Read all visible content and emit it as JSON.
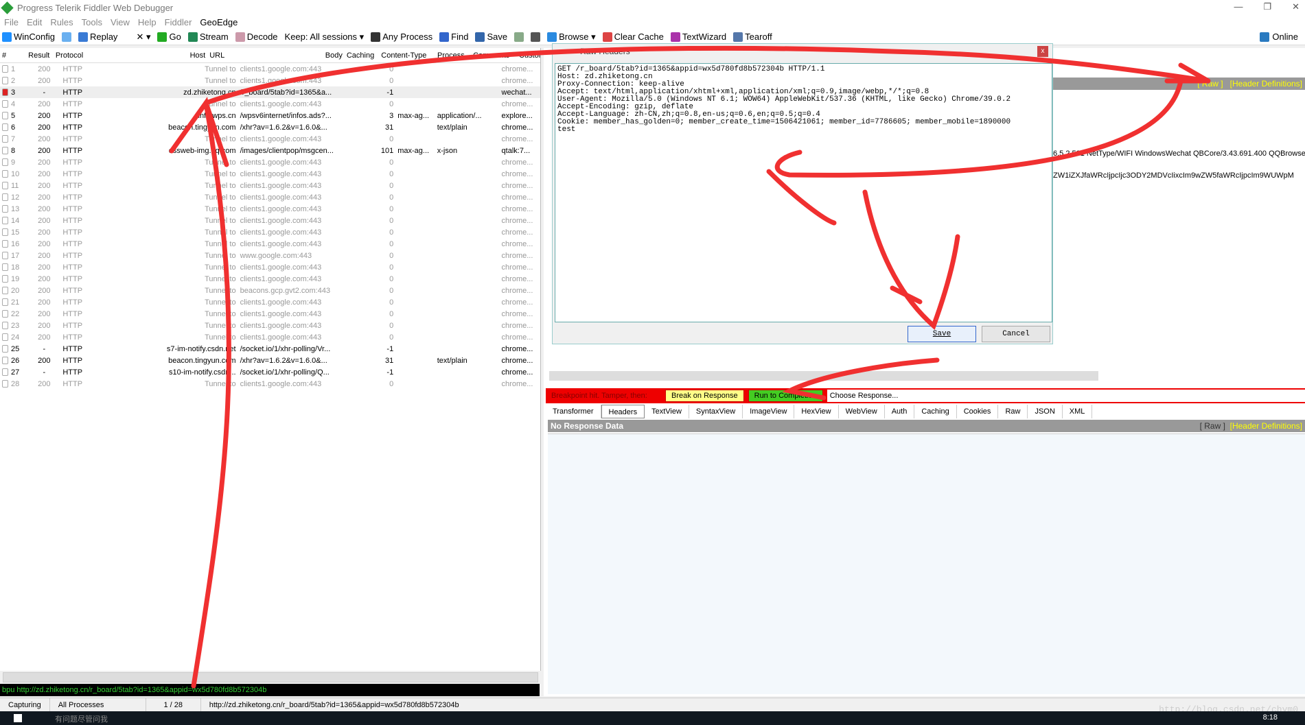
{
  "window": {
    "title": "Progress Telerik Fiddler Web Debugger",
    "controls": [
      "—",
      "❐",
      "✕"
    ]
  },
  "menu": [
    "File",
    "Edit",
    "Rules",
    "Tools",
    "View",
    "Help",
    "Fiddler",
    "GeoEdge"
  ],
  "toolbar": [
    {
      "label": "WinConfig",
      "icon": "windows-icon",
      "color": "#1e90ff"
    },
    {
      "label": "",
      "icon": "comment-icon",
      "color": "#6ab0f0"
    },
    {
      "label": "Replay",
      "icon": "replay-icon",
      "color": "#3a7bd5"
    },
    {
      "label": "✕ ▾",
      "icon": "remove-icon",
      "color": "#fff"
    },
    {
      "label": "Go",
      "icon": "play-icon",
      "color": "#2a2"
    },
    {
      "label": "Stream",
      "icon": "stream-icon",
      "color": "#285"
    },
    {
      "label": "Decode",
      "icon": "decode-icon",
      "color": "#c9a"
    },
    {
      "label": "Keep: All sessions ▾",
      "icon": "",
      "color": ""
    },
    {
      "label": "Any Process",
      "icon": "crosshair-icon",
      "color": "#333"
    },
    {
      "label": "Find",
      "icon": "binoculars-icon",
      "color": "#36c"
    },
    {
      "label": "Save",
      "icon": "save-icon",
      "color": "#36a"
    },
    {
      "label": "",
      "icon": "screenshot-icon",
      "color": "#8a8"
    },
    {
      "label": "",
      "icon": "timer-icon",
      "color": "#555"
    },
    {
      "label": "Browse ▾",
      "icon": "ie-icon",
      "color": "#2a8ae0"
    },
    {
      "label": "Clear Cache",
      "icon": "clear-cache-icon",
      "color": "#d44"
    },
    {
      "label": "TextWizard",
      "icon": "textwizard-icon",
      "color": "#a3a"
    },
    {
      "label": "Tearoff",
      "icon": "tearoff-icon",
      "color": "#57a"
    }
  ],
  "online": "Online",
  "sessions": {
    "columns": [
      "#",
      "Result",
      "Protocol",
      "Host",
      "URL",
      "Body",
      "Caching",
      "Content-Type",
      "Process",
      "Comments",
      "Custom"
    ],
    "rows": [
      [
        "1",
        "200",
        "HTTP",
        "Tunnel to",
        "clients1.google.com:443",
        "0",
        "",
        "",
        "chrome..."
      ],
      [
        "2",
        "200",
        "HTTP",
        "Tunnel to",
        "clients1.google.com:443",
        "0",
        "",
        "",
        "chrome..."
      ],
      [
        "3",
        "-",
        "HTTP",
        "zd.zhiketong.cn",
        "/r_board/5tab?id=1365&a...",
        "-1",
        "",
        "",
        "wechat..."
      ],
      [
        "4",
        "200",
        "HTTP",
        "Tunnel to",
        "clients1.google.com:443",
        "0",
        "",
        "",
        "chrome..."
      ],
      [
        "5",
        "200",
        "HTTP",
        "info.wps.cn",
        "/wpsv6internet/infos.ads?...",
        "3",
        "max-ag...",
        "application/...",
        "explore..."
      ],
      [
        "6",
        "200",
        "HTTP",
        "beacon.tingyun.com",
        "/xhr?av=1.6.2&v=1.6.0&...",
        "31",
        "",
        "text/plain",
        "chrome..."
      ],
      [
        "7",
        "200",
        "HTTP",
        "Tunnel to",
        "clients1.google.com:443",
        "0",
        "",
        "",
        "chrome..."
      ],
      [
        "8",
        "200",
        "HTTP",
        "ossweb-img.qq.com",
        "/images/clientpop/msgcen...",
        "101",
        "max-ag...",
        "x-json",
        "qtalk:7..."
      ],
      [
        "9",
        "200",
        "HTTP",
        "Tunnel to",
        "clients1.google.com:443",
        "0",
        "",
        "",
        "chrome..."
      ],
      [
        "10",
        "200",
        "HTTP",
        "Tunnel to",
        "clients1.google.com:443",
        "0",
        "",
        "",
        "chrome..."
      ],
      [
        "11",
        "200",
        "HTTP",
        "Tunnel to",
        "clients1.google.com:443",
        "0",
        "",
        "",
        "chrome..."
      ],
      [
        "12",
        "200",
        "HTTP",
        "Tunnel to",
        "clients1.google.com:443",
        "0",
        "",
        "",
        "chrome..."
      ],
      [
        "13",
        "200",
        "HTTP",
        "Tunnel to",
        "clients1.google.com:443",
        "0",
        "",
        "",
        "chrome..."
      ],
      [
        "14",
        "200",
        "HTTP",
        "Tunnel to",
        "clients1.google.com:443",
        "0",
        "",
        "",
        "chrome..."
      ],
      [
        "15",
        "200",
        "HTTP",
        "Tunnel to",
        "clients1.google.com:443",
        "0",
        "",
        "",
        "chrome..."
      ],
      [
        "16",
        "200",
        "HTTP",
        "Tunnel to",
        "clients1.google.com:443",
        "0",
        "",
        "",
        "chrome..."
      ],
      [
        "17",
        "200",
        "HTTP",
        "Tunnel to",
        "www.google.com:443",
        "0",
        "",
        "",
        "chrome..."
      ],
      [
        "18",
        "200",
        "HTTP",
        "Tunnel to",
        "clients1.google.com:443",
        "0",
        "",
        "",
        "chrome..."
      ],
      [
        "19",
        "200",
        "HTTP",
        "Tunnel to",
        "clients1.google.com:443",
        "0",
        "",
        "",
        "chrome..."
      ],
      [
        "20",
        "200",
        "HTTP",
        "Tunnel to",
        "beacons.gcp.gvt2.com:443",
        "0",
        "",
        "",
        "chrome..."
      ],
      [
        "21",
        "200",
        "HTTP",
        "Tunnel to",
        "clients1.google.com:443",
        "0",
        "",
        "",
        "chrome..."
      ],
      [
        "22",
        "200",
        "HTTP",
        "Tunnel to",
        "clients1.google.com:443",
        "0",
        "",
        "",
        "chrome..."
      ],
      [
        "23",
        "200",
        "HTTP",
        "Tunnel to",
        "clients1.google.com:443",
        "0",
        "",
        "",
        "chrome..."
      ],
      [
        "24",
        "200",
        "HTTP",
        "Tunnel to",
        "clients1.google.com:443",
        "0",
        "",
        "",
        "chrome..."
      ],
      [
        "25",
        "-",
        "HTTP",
        "s7-im-notify.csdn.net",
        "/socket.io/1/xhr-polling/Vr...",
        "-1",
        "",
        "",
        "chrome..."
      ],
      [
        "26",
        "200",
        "HTTP",
        "beacon.tingyun.com",
        "/xhr?av=1.6.2&v=1.6.0&...",
        "31",
        "",
        "text/plain",
        "chrome..."
      ],
      [
        "27",
        "-",
        "HTTP",
        "s10-im-notify.csdn...",
        "/socket.io/1/xhr-polling/Q...",
        "-1",
        "",
        "",
        "chrome..."
      ],
      [
        "28",
        "200",
        "HTTP",
        "Tunnel to",
        "clients1.google.com:443",
        "0",
        "",
        "",
        "chrome..."
      ]
    ]
  },
  "quickexec": "bpu http://zd.zhiketong.cn/r_board/5tab?id=1365&appid=wx5d780fd8b572304b",
  "status": {
    "capture": "Capturing",
    "filter": "All Processes",
    "count": "1 / 28",
    "url": "http://zd.zhiketong.cn/r_board/5tab?id=1365&appid=wx5d780fd8b572304b"
  },
  "taskbar": {
    "search": "有问题尽管问我",
    "time": "8:18"
  },
  "request_pane": {
    "raw": "[ Raw ]",
    "header_defs": "[Header Definitions]",
    "ua_fragment": "6.5.2.501 NetType/WIFI WindowsWechat QBCore/3.43.691.400 QQBrowser",
    "cookie_fragment": "ZW1iZXJfaWRcIjpcIjc3ODY2MDVcIixcIm9wZW5faWRcIjpcIm9WUWpM"
  },
  "dialog": {
    "title": "Raw Headers",
    "close": "x",
    "text": "GET /r_board/5tab?id=1365&appid=wx5d780fd8b572304b HTTP/1.1\nHost: zd.zhiketong.cn\nProxy-Connection: keep-alive\nAccept: text/html,application/xhtml+xml,application/xml;q=0.9,image/webp,*/*;q=0.8\nUser-Agent: Mozilla/5.0 (Windows NT 6.1; WOW64) AppleWebKit/537.36 (KHTML, like Gecko) Chrome/39.0.2\nAccept-Encoding: gzip, deflate\nAccept-Language: zh-CN,zh;q=0.8,en-us;q=0.6,en;q=0.5;q=0.4\nCookie: member_has_golden=0; member_create_time=1506421061; member_id=7786605; member_mobile=1890000\ntest",
    "save": "Save",
    "cancel": "Cancel"
  },
  "breakpoint": {
    "label": "Breakpoint hit. Tamper, then:",
    "break_on_response": "Break on Response",
    "run_to_completion": "Run to Completion",
    "choose_response": "Choose Response..."
  },
  "response_tabs": [
    "Transformer",
    "Headers",
    "TextView",
    "SyntaxView",
    "ImageView",
    "HexView",
    "WebView",
    "Auth",
    "Caching",
    "Cookies",
    "Raw",
    "JSON",
    "XML"
  ],
  "response": {
    "no_data": "No Response Data",
    "raw": "[ Raw ]",
    "header_defs": "[Header Definitions]"
  },
  "watermark": "http://blog.csdn.net/chym0",
  "colors": {
    "annotation": "#f03030",
    "breakpoint_bar": "#e00000",
    "run_green": "#44cc22",
    "break_yellow": "#ffff88"
  }
}
